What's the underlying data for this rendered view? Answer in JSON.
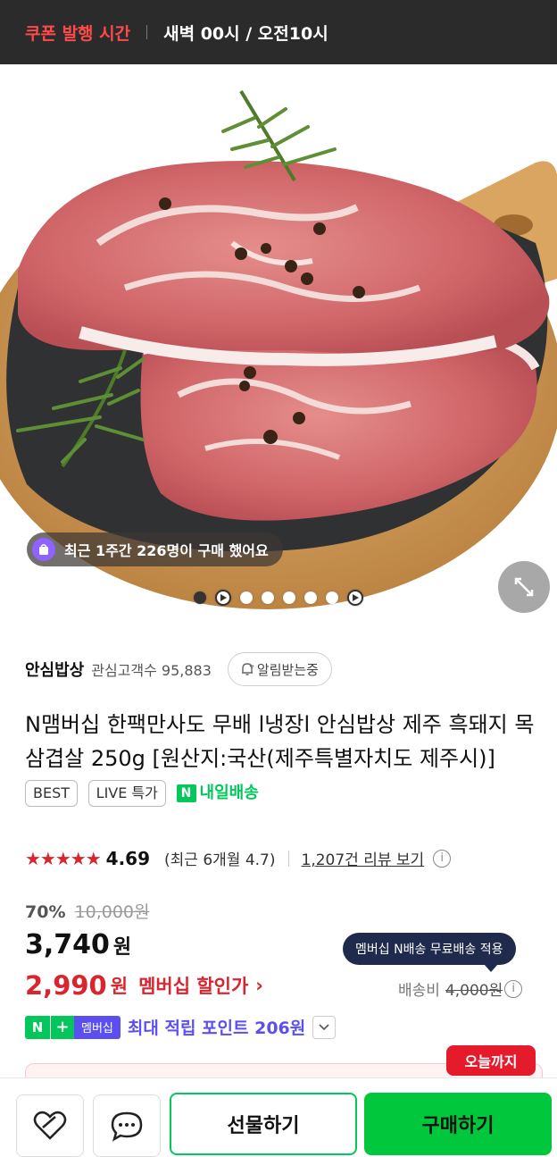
{
  "topbar": {
    "coupon_label": "쿠폰 발행 시간",
    "time_text": "새벽 00시 / 오전10시"
  },
  "hero": {
    "buyers_text": "최근 1주간 226명이 구매 했어요",
    "image_desc_icon": "pork-shoulder-steak-photo"
  },
  "store": {
    "name": "안심밥상",
    "fans_label": "관심고객수 95,883",
    "alert_label": "알림받는중"
  },
  "product": {
    "title": "N맴버십 한팩만사도 무배 l냉장l 안심밥상 제주 흑돼지 목삼겹살 250g [원산지:국산(제주특별자치도 제주시)]",
    "badges": [
      "BEST",
      "LIVE 특가"
    ],
    "delivery_tag": "내일배송",
    "delivery_icon_text": "N"
  },
  "rating": {
    "stars": "★★★★★",
    "score": "4.69",
    "recent": "(최근 6개월 4.7)",
    "reviews_link": "1,207건 리뷰 보기"
  },
  "pricing": {
    "discount_pct": "70%",
    "original_price": "10,000원",
    "price": "3,740",
    "price_unit": "원",
    "member_price": "2,990",
    "member_unit": "원",
    "member_label": "멤버십 할인가",
    "member_chevron": "›"
  },
  "shipping": {
    "bubble_text": "멤버십 N배송 무료배송 적용",
    "fee_label": "배송비",
    "fee_original": "4,000원"
  },
  "points": {
    "n_label": "N",
    "plus_label": "+",
    "membership_label": "멤버십",
    "points_text": "최대 적립 포인트 206원"
  },
  "promo": {
    "today_badge": "오늘까지"
  },
  "bottom": {
    "gift_label": "선물하기",
    "buy_label": "구매하기"
  },
  "colors": {
    "accent_red": "#d9262e",
    "naver_green": "#03c75a",
    "membership_purple": "#5b4ff0",
    "topbar_bg": "#2b2b2b"
  }
}
